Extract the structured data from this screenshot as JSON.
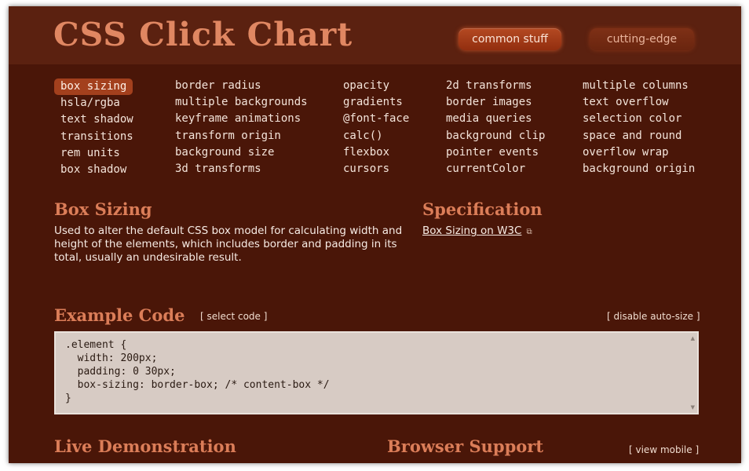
{
  "header": {
    "title": "CSS Click Chart",
    "buttons": [
      "common stuff",
      "cutting-edge"
    ]
  },
  "properties": {
    "columns": [
      [
        "box sizing",
        "hsla/rgba",
        "text shadow",
        "transitions",
        "rem units",
        "box shadow"
      ],
      [
        "border radius",
        "multiple backgrounds",
        "keyframe animations",
        "transform origin",
        "background size",
        "3d transforms"
      ],
      [
        "opacity",
        "gradients",
        "@font-face",
        "calc()",
        "flexbox",
        "cursors"
      ],
      [
        "2d transforms",
        "border images",
        "media queries",
        "background clip",
        "pointer events",
        "currentColor"
      ],
      [
        "multiple columns",
        "text overflow",
        "selection color",
        "space and round",
        "overflow wrap",
        "background origin"
      ]
    ],
    "active": "box sizing"
  },
  "detail": {
    "heading": "Box Sizing",
    "description": "Used to alter the default CSS box model for calculating width and height of the elements, which includes border and padding in its total, usually an undesirable result."
  },
  "spec": {
    "heading": "Specification",
    "link": "Box Sizing on W3C"
  },
  "example": {
    "heading": "Example Code",
    "select_code": "[ select code ]",
    "disable_autosize": "[ disable auto-size ]",
    "code": ".element {\n  width: 200px;\n  padding: 0 30px;\n  box-sizing: border-box; /* content-box */\n}"
  },
  "live": {
    "heading": "Live Demonstration"
  },
  "support": {
    "heading": "Browser Support",
    "view_mobile": "[ view mobile ]"
  },
  "colors": {
    "background": "#4a1608",
    "header": "#5b2110",
    "accent": "#db7d58",
    "active_item": "#a3401d"
  }
}
